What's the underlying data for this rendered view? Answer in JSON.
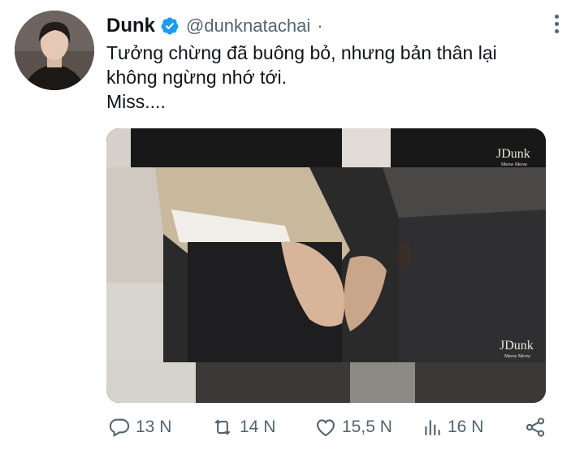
{
  "tweet": {
    "author_name": "Dunk",
    "author_handle": "@dunknatachai",
    "separator": "·",
    "text_lines": [
      "Tưởng chừng đã buông bỏ, nhưng bản thân lại",
      "không ngừng nhớ tới.",
      "Miss...."
    ],
    "media": {
      "watermark_top": "JDunk",
      "watermark_top_sub": "Meow Meow",
      "watermark_bottom": "JDunk",
      "watermark_bottom_sub": "Meow Meow"
    },
    "actions": {
      "replies": "13 N",
      "retweets": "14 N",
      "likes": "15,5 N",
      "views": "16 N"
    }
  },
  "colors": {
    "verified": "#1d9bf0",
    "secondary_text": "#536471",
    "primary_text": "#0f1419"
  }
}
